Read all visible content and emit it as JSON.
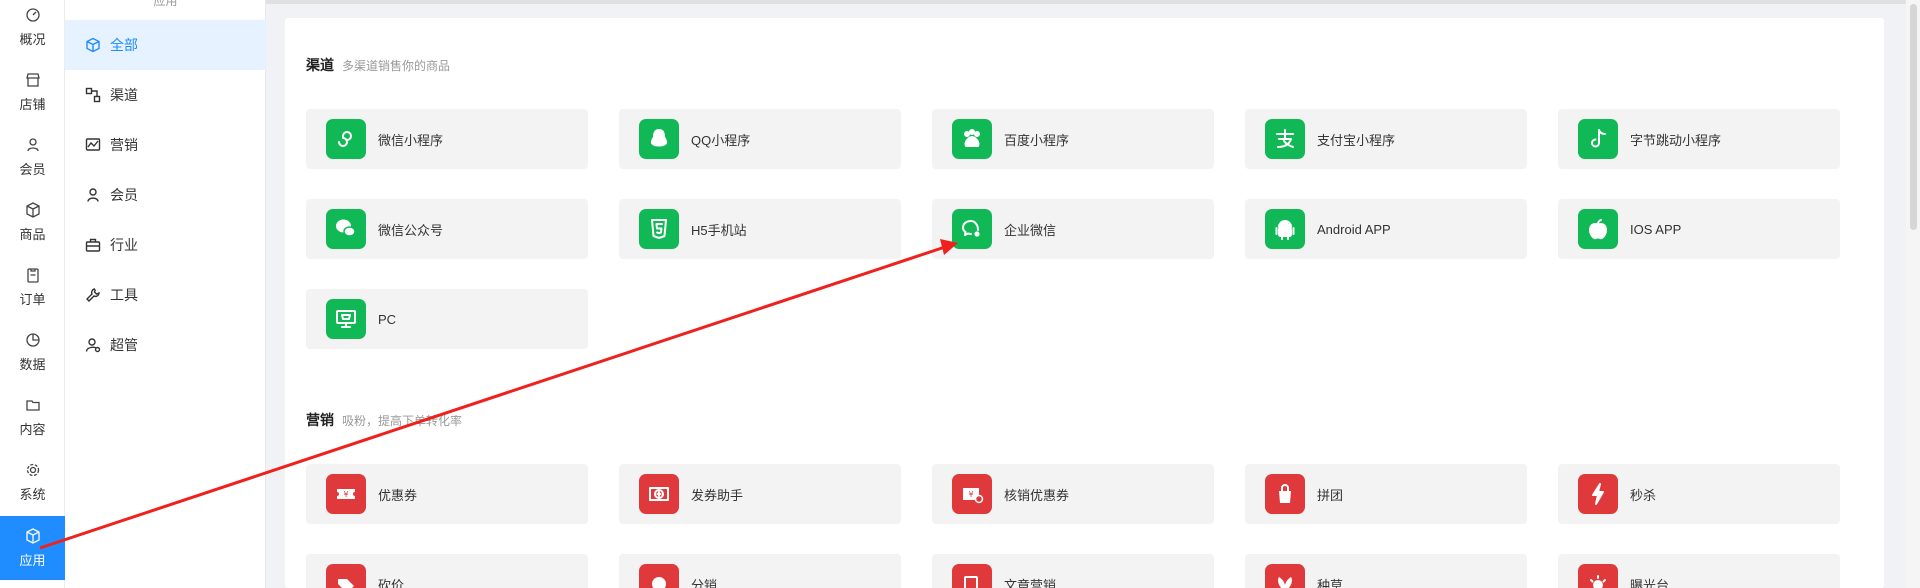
{
  "rail": {
    "items": [
      {
        "label": "概况",
        "icon": "dashboard-icon"
      },
      {
        "label": "店铺",
        "icon": "store-icon"
      },
      {
        "label": "会员",
        "icon": "member-icon"
      },
      {
        "label": "商品",
        "icon": "product-icon"
      },
      {
        "label": "订单",
        "icon": "order-icon"
      },
      {
        "label": "数据",
        "icon": "data-icon"
      },
      {
        "label": "内容",
        "icon": "content-icon"
      },
      {
        "label": "系统",
        "icon": "system-icon"
      },
      {
        "label": "应用",
        "icon": "app-icon",
        "active": true
      }
    ]
  },
  "submenu": {
    "heading": "应用",
    "items": [
      {
        "label": "全部",
        "icon": "cube-icon",
        "active": true
      },
      {
        "label": "渠道",
        "icon": "channel-icon"
      },
      {
        "label": "营销",
        "icon": "marketing-icon"
      },
      {
        "label": "会员",
        "icon": "member-icon"
      },
      {
        "label": "行业",
        "icon": "industry-icon"
      },
      {
        "label": "工具",
        "icon": "tool-icon"
      },
      {
        "label": "超管",
        "icon": "admin-icon"
      }
    ]
  },
  "sections": {
    "channel": {
      "title": "渠道",
      "subtitle": "多渠道销售你的商品",
      "apps": [
        {
          "name": "微信小程序",
          "icon": "wechat-miniprogram-icon"
        },
        {
          "name": "QQ小程序",
          "icon": "qq-icon"
        },
        {
          "name": "百度小程序",
          "icon": "baidu-icon"
        },
        {
          "name": "支付宝小程序",
          "icon": "alipay-icon"
        },
        {
          "name": "字节跳动小程序",
          "icon": "tiktok-icon"
        },
        {
          "name": "微信公众号",
          "icon": "wechat-icon"
        },
        {
          "name": "H5手机站",
          "icon": "html5-icon"
        },
        {
          "name": "企业微信",
          "icon": "wecom-icon"
        },
        {
          "name": "Android APP",
          "icon": "android-icon"
        },
        {
          "name": "IOS APP",
          "icon": "apple-icon"
        },
        {
          "name": "PC",
          "icon": "pc-icon"
        }
      ]
    },
    "marketing": {
      "title": "营销",
      "subtitle": "吸粉，提高下单转化率",
      "apps": [
        {
          "name": "优惠券",
          "icon": "coupon-icon"
        },
        {
          "name": "发券助手",
          "icon": "coupon-assistant-icon"
        },
        {
          "name": "核销优惠券",
          "icon": "verify-coupon-icon"
        },
        {
          "name": "拼团",
          "icon": "group-buy-icon"
        },
        {
          "name": "秒杀",
          "icon": "flash-sale-icon"
        },
        {
          "name": "砍价",
          "icon": "bargain-icon"
        },
        {
          "name": "分销",
          "icon": "distribution-icon"
        },
        {
          "name": "文章营销",
          "icon": "article-icon"
        },
        {
          "name": "种草",
          "icon": "grass-icon"
        },
        {
          "name": "曝光台",
          "icon": "exposure-icon"
        }
      ]
    }
  },
  "colors": {
    "accent": "#1f8cff",
    "channel_green": "#10b955",
    "marketing_red": "#e0393c",
    "annotation_arrow": "#f0201d"
  }
}
